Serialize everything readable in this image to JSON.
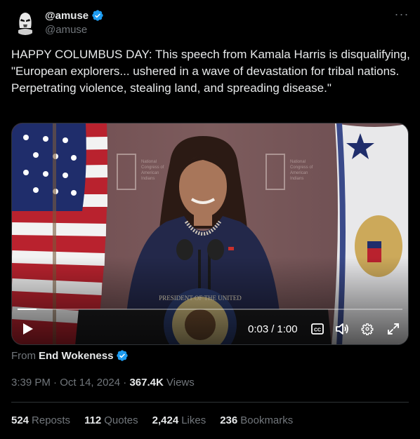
{
  "author": {
    "display_name": "@amuse",
    "handle": "@amuse",
    "verified": true,
    "avatar_icon": "stormtrooper-avatar-icon"
  },
  "more_label": "···",
  "tweet": {
    "text": "HAPPY COLUMBUS DAY: This speech from Kamala Harris is disqualifying, \"European explorers... ushered in a wave of devastation for tribal nations. Perpetrating violence, stealing land, and spreading disease.\""
  },
  "video": {
    "current_time": "0:03",
    "separator": "/",
    "duration": "1:00",
    "progress_fraction": 0.05,
    "backdrop_text": "National Congress of American Indians",
    "podium_seal_text": "PRESIDENT OF THE UNITED STATES",
    "icons": [
      "play-icon",
      "closed-captions-icon",
      "volume-icon",
      "settings-gear-icon",
      "fullscreen-icon"
    ]
  },
  "from": {
    "prefix": "From",
    "source": "End Wokeness",
    "verified": true
  },
  "meta": {
    "time": "3:39 PM",
    "date": "Oct 14, 2024",
    "views_count": "367.4K",
    "views_label": "Views",
    "dot": "·"
  },
  "stats": {
    "reposts_count": "524",
    "reposts_label": "Reposts",
    "quotes_count": "112",
    "quotes_label": "Quotes",
    "likes_count": "2,424",
    "likes_label": "Likes",
    "bookmarks_count": "236",
    "bookmarks_label": "Bookmarks"
  },
  "colors": {
    "background": "#000000",
    "text_primary": "#e7e9ea",
    "text_secondary": "#71767b",
    "verified_blue": "#1d9bf0",
    "divider": "#2f3336"
  }
}
